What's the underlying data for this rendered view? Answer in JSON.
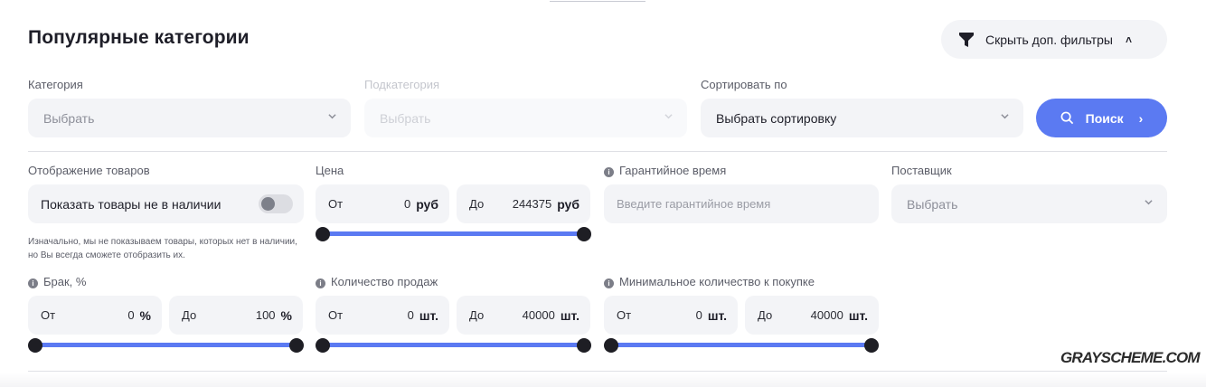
{
  "header": {
    "title": "Популярные категории",
    "filters_toggle_label": "Скрыть доп. фильтры"
  },
  "top_filters": {
    "category": {
      "label": "Категория",
      "value": "Выбрать"
    },
    "subcategory": {
      "label": "Подкатегория",
      "value": "Выбрать",
      "disabled": true
    },
    "sort": {
      "label": "Сортировать по",
      "value": "Выбрать сортировку"
    },
    "search_label": "Поиск"
  },
  "display": {
    "label": "Отображение товаров",
    "toggle_label": "Показать товары не в наличии",
    "toggle_on": false,
    "hint": "Изначально, мы не показываем товары, которых нет в наличии, но Вы всегда сможете отобразить их."
  },
  "price": {
    "label": "Цена",
    "from_label": "От",
    "from_value": "0",
    "from_unit": "руб",
    "to_label": "До",
    "to_value": "244375",
    "to_unit": "руб",
    "min": 0,
    "max": 244375
  },
  "warranty": {
    "label": "Гарантийное время",
    "placeholder": "Введите гарантийное время"
  },
  "supplier": {
    "label": "Поставщик",
    "value": "Выбрать"
  },
  "defect": {
    "label": "Брак, %",
    "from_label": "От",
    "from_value": "0",
    "from_unit": "%",
    "to_label": "До",
    "to_value": "100",
    "to_unit": "%",
    "min": 0,
    "max": 100
  },
  "sales": {
    "label": "Количество продаж",
    "from_label": "От",
    "from_value": "0",
    "from_unit": "шт.",
    "to_label": "До",
    "to_value": "40000",
    "to_unit": "шт.",
    "min": 0,
    "max": 40000
  },
  "min_purchase": {
    "label": "Минимальное количество к покупке",
    "from_label": "От",
    "from_value": "0",
    "from_unit": "шт.",
    "to_label": "До",
    "to_value": "40000",
    "to_unit": "шт.",
    "min": 0,
    "max": 40000
  },
  "watermark": "GRAYSCHEME.COM",
  "colors": {
    "accent": "#5b7af2",
    "field_bg": "#f3f4f7",
    "text": "#1e1e28",
    "handle": "#1e1e24"
  },
  "icons": {
    "filter": "funnel-icon",
    "caret": "chevron-up-icon",
    "select": "chevron-down-icon",
    "search": "search-icon",
    "search_arrow": "chevron-right-icon",
    "info": "info-icon"
  }
}
